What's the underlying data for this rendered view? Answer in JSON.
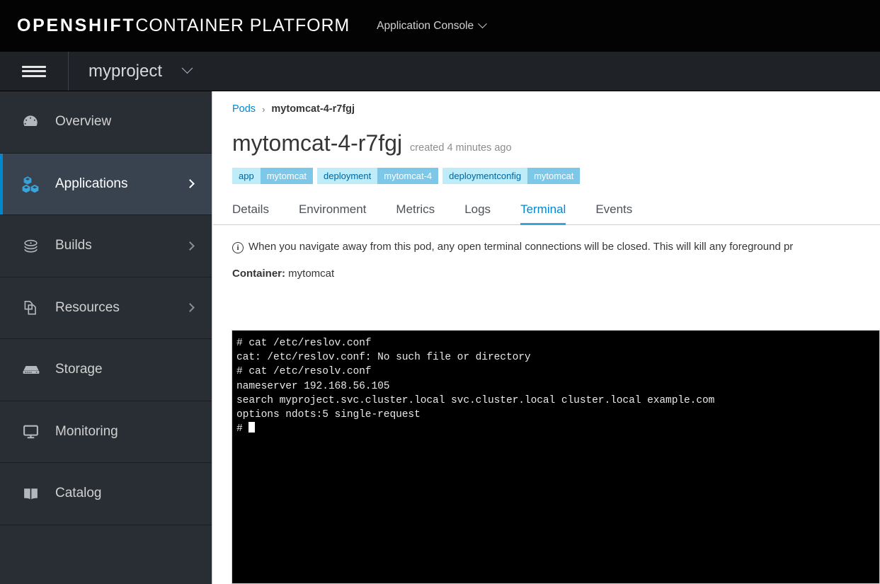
{
  "masthead": {
    "brand_bold": "OPENSHIFT",
    "brand_light": "CONTAINER PLATFORM",
    "console_selector": "Application Console",
    "caret_icon": "chevron-down-icon"
  },
  "projectbar": {
    "menu_icon": "hamburger-icon",
    "project_name": "myproject",
    "caret_icon": "chevron-down-icon"
  },
  "sidebar": {
    "items": [
      {
        "label": "Overview",
        "icon": "dashboard-icon",
        "active": false,
        "has_arrow": false
      },
      {
        "label": "Applications",
        "icon": "cubes-icon",
        "active": true,
        "has_arrow": true
      },
      {
        "label": "Builds",
        "icon": "layers-icon",
        "active": false,
        "has_arrow": true
      },
      {
        "label": "Resources",
        "icon": "files-icon",
        "active": false,
        "has_arrow": true
      },
      {
        "label": "Storage",
        "icon": "storage-icon",
        "active": false,
        "has_arrow": false
      },
      {
        "label": "Monitoring",
        "icon": "monitor-icon",
        "active": false,
        "has_arrow": false
      },
      {
        "label": "Catalog",
        "icon": "book-icon",
        "active": false,
        "has_arrow": false
      }
    ]
  },
  "breadcrumb": {
    "parent": "Pods",
    "separator": "›",
    "current": "mytomcat-4-r7fgj"
  },
  "page": {
    "title": "mytomcat-4-r7fgj",
    "subtitle": "created 4 minutes ago"
  },
  "labels": [
    {
      "key": "app",
      "value": "mytomcat"
    },
    {
      "key": "deployment",
      "value": "mytomcat-4"
    },
    {
      "key": "deploymentconfig",
      "value": "mytomcat"
    }
  ],
  "tabs": [
    {
      "label": "Details",
      "active": false
    },
    {
      "label": "Environment",
      "active": false
    },
    {
      "label": "Metrics",
      "active": false
    },
    {
      "label": "Logs",
      "active": false
    },
    {
      "label": "Terminal",
      "active": true
    },
    {
      "label": "Events",
      "active": false
    }
  ],
  "alert": {
    "icon": "info-circle-icon",
    "icon_glyph": "i",
    "text": "When you navigate away from this pod, any open terminal connections will be closed. This will kill any foreground pr"
  },
  "container": {
    "key": "Container:",
    "value": "mytomcat"
  },
  "terminal": {
    "lines": [
      "# cat /etc/reslov.conf",
      "cat: /etc/reslov.conf: No such file or directory",
      "# cat /etc/resolv.conf",
      "nameserver 192.168.56.105",
      "search myproject.svc.cluster.local svc.cluster.local cluster.local example.com",
      "options ndots:5 single-request"
    ],
    "prompt": "#",
    "cursor": "block"
  },
  "colors": {
    "masthead_bg": "#030303",
    "projectbar_bg": "#1f2226",
    "sidebar_bg": "#292e34",
    "sidebar_active_bg": "#39434f",
    "accent_blue": "#0088ce",
    "tab_underline": "#39a5dc",
    "label_key_bg": "#beedf9",
    "label_val_bg": "#7dc8e8",
    "terminal_bg": "#000000",
    "terminal_fg": "#e8e8e8"
  }
}
